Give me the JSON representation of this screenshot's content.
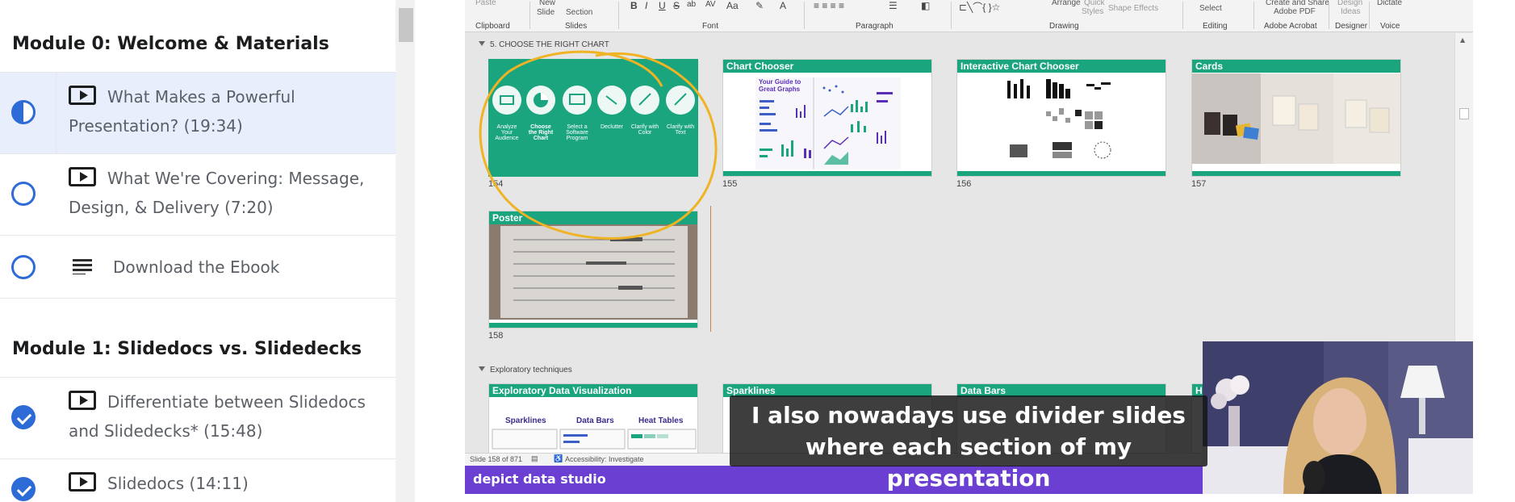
{
  "course": {
    "modules": [
      {
        "title": "Module 0: Welcome & Materials",
        "lectures": [
          {
            "line1": "What Makes a Powerful",
            "line2": "Presentation? (19:34)",
            "type": "video",
            "status": "in-progress"
          },
          {
            "line1": "What We're Covering: Message,",
            "line2": "Design, & Delivery (7:20)",
            "type": "video",
            "status": "not-started"
          },
          {
            "line1": "Download the Ebook",
            "line2": "",
            "type": "document",
            "status": "not-started"
          }
        ]
      },
      {
        "title": "Module 1: Slidedocs vs. Slidedecks",
        "lectures": [
          {
            "line1": "Differentiate between Slidedocs",
            "line2": "and Slidedecks* (15:48)",
            "type": "video",
            "status": "completed"
          },
          {
            "line1": "Slidedocs (14:11)",
            "line2": "",
            "type": "video",
            "status": "completed"
          }
        ]
      }
    ]
  },
  "ribbon": {
    "clipboard": {
      "label": "Clipboard",
      "paste": "Paste"
    },
    "slides": {
      "label": "Slides",
      "new_slide_1": "New",
      "new_slide_2": "Slide",
      "section": "Section"
    },
    "font": {
      "label": "Font",
      "buttons": [
        "B",
        "I",
        "U",
        "S",
        "ab",
        "AV",
        "Aa"
      ]
    },
    "paragraph": {
      "label": "Paragraph"
    },
    "drawing": {
      "label": "Drawing",
      "arrange": "Arrange",
      "quick_styles_1": "Quick",
      "quick_styles_2": "Styles",
      "shape_effects": "Shape Effects"
    },
    "editing": {
      "label": "Editing",
      "select": "Select"
    },
    "adobe": {
      "label": "Adobe Acrobat",
      "line1": "Create and Share",
      "line2": "Adobe PDF"
    },
    "designer": {
      "label": "Designer",
      "line1": "Design",
      "line2": "Ideas"
    },
    "voice": {
      "label": "Voice",
      "dictate": "Dictate"
    }
  },
  "sections": [
    {
      "label": "5. CHOOSE THE RIGHT CHART",
      "slides": [
        {
          "num": "154",
          "title": "",
          "icons": [
            "Analyze Your Audience",
            "Choose the Right Chart",
            "Select a Software Program",
            "Declutter",
            "Clarify with Color",
            "Clarify with Text"
          ]
        },
        {
          "num": "155",
          "title": "Chart Chooser",
          "subtitle": "Your Guide to Great Graphs"
        },
        {
          "num": "156",
          "title": "Interactive Chart Chooser"
        },
        {
          "num": "157",
          "title": "Cards"
        },
        {
          "num": "158",
          "title": "Poster"
        }
      ]
    },
    {
      "label": "Exploratory techniques",
      "slides": [
        {
          "title": "Exploratory Data Visualization",
          "subs": [
            "Sparklines",
            "Data Bars",
            "Heat Tables"
          ]
        },
        {
          "title": "Sparklines"
        },
        {
          "title": "Data Bars"
        },
        {
          "title": "He"
        }
      ]
    }
  ],
  "status_bar": {
    "slide_count": "Slide 158 of 871",
    "accessibility": "Accessibility: Investigate"
  },
  "brand": "depict data studio",
  "caption": {
    "line1": "I also nowadays use divider slides",
    "line2": "where each section of my presentation"
  },
  "colors": {
    "slide_green": "#1aa57f",
    "brand_purple": "#6a3fd1",
    "highlight_circle": "#f0b323",
    "check_blue": "#2d6bd6"
  }
}
